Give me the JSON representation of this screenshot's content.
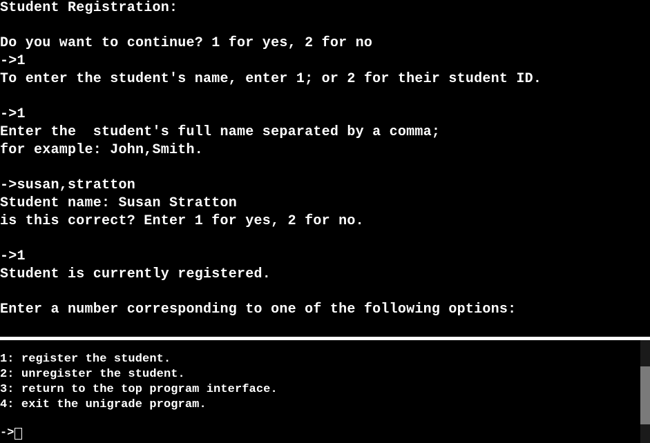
{
  "top_pane": {
    "lines": [
      "Student Registration:",
      "",
      "Do you want to continue? 1 for yes, 2 for no",
      "->1",
      "To enter the student's name, enter 1; or 2 for their student ID.",
      "",
      "->1",
      "Enter the  student's full name separated by a comma;",
      "for example: John,Smith.",
      "",
      "->susan,stratton",
      "Student name: Susan Stratton",
      "is this correct? Enter 1 for yes, 2 for no.",
      "",
      "->1",
      "Student is currently registered.",
      "",
      "Enter a number corresponding to one of the following options:"
    ]
  },
  "bottom_pane": {
    "options": [
      "1: register the student.",
      "2: unregister the student.",
      "3: return to the top program interface.",
      "4: exit the unigrade program."
    ],
    "prompt": "->",
    "input_value": ""
  },
  "colors": {
    "background": "#000000",
    "text": "#ffffff",
    "divider": "#ffffff",
    "scroll_thumb": "#7a7a7a"
  }
}
